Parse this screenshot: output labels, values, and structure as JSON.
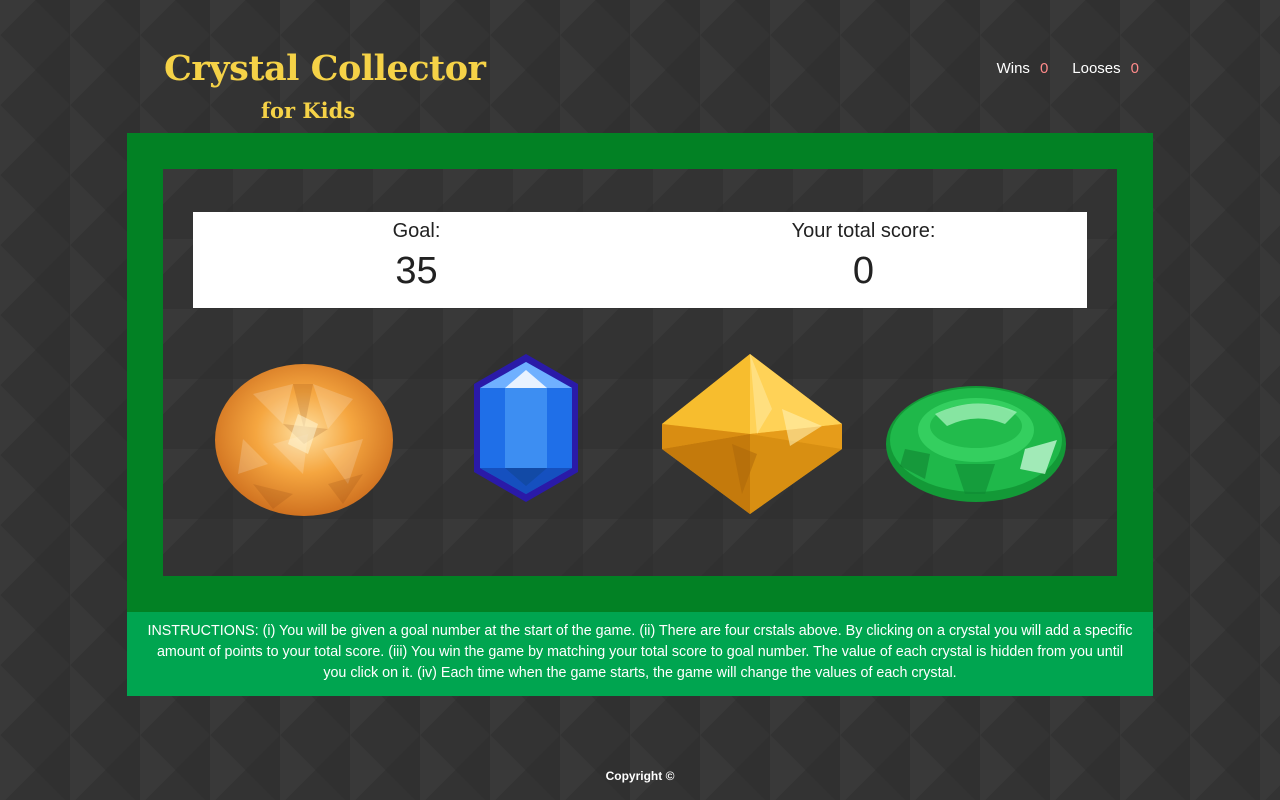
{
  "header": {
    "title": "Crystal Collector",
    "subtitle": "for Kids"
  },
  "scoreboard": {
    "wins_label": "Wins",
    "wins_value": "0",
    "losses_label": "Looses",
    "losses_value": "0"
  },
  "game": {
    "goal_label": "Goal:",
    "goal_value": "35",
    "total_label": "Your total score:",
    "total_value": "0"
  },
  "crystals": [
    {
      "name": "orange-crystal",
      "color": "#f29a2e"
    },
    {
      "name": "blue-crystal",
      "color": "#1f6fe8"
    },
    {
      "name": "yellow-crystal",
      "color": "#f4b21f"
    },
    {
      "name": "green-crystal",
      "color": "#1fb84a"
    }
  ],
  "instructions": {
    "text": "INSTRUCTIONS: (i) You will be given a goal number at the start of the game. (ii) There are four crstals above. By clicking on a crystal you will add a specific amount of points to your total score. (iii) You win the game by matching your total score to goal number. The value of each crystal is hidden from you until you click on it. (iv) Each time when the game starts, the game will change the values of each crystal."
  },
  "footer": {
    "copyright": "Copyright ©"
  },
  "colors": {
    "title": "#f5d247",
    "frame_green": "#028124",
    "instructions_green": "#00a550",
    "counter_red": "#ff8a8a",
    "background": "#333333"
  }
}
